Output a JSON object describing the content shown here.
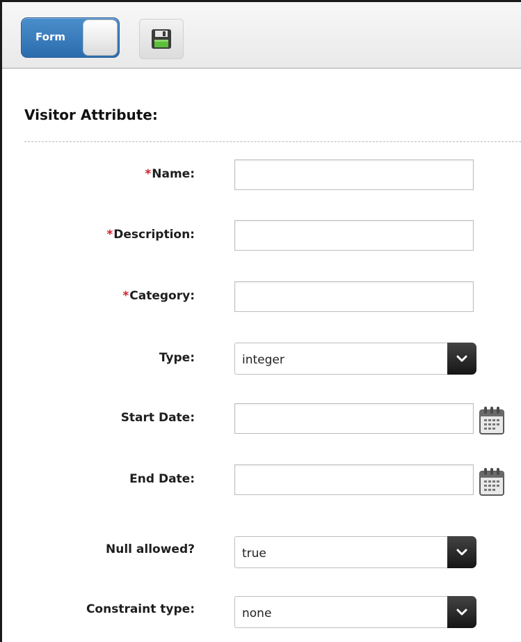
{
  "toolbar": {
    "mode_toggle_label": "Form",
    "save_icon": "floppy-disk-icon"
  },
  "section": {
    "title": "Visitor Attribute:"
  },
  "fields": {
    "name": {
      "required": "*",
      "label": "Name:",
      "value": ""
    },
    "description": {
      "required": "*",
      "label": "Description:",
      "value": ""
    },
    "category": {
      "required": "*",
      "label": "Category:",
      "value": ""
    },
    "type": {
      "label": "Type:",
      "value": "integer"
    },
    "start_date": {
      "label": "Start Date:",
      "value": "",
      "icon": "calendar-icon"
    },
    "end_date": {
      "label": "End Date:",
      "value": "",
      "icon": "calendar-icon"
    },
    "null_allowed": {
      "label": "Null allowed?",
      "value": "true"
    },
    "constraint_type": {
      "label": "Constraint type:",
      "value": "none"
    }
  },
  "colors": {
    "toggle_blue": "#2c6cae",
    "required_red": "#d0202a",
    "dropdown_dark": "#1a1a1a"
  }
}
